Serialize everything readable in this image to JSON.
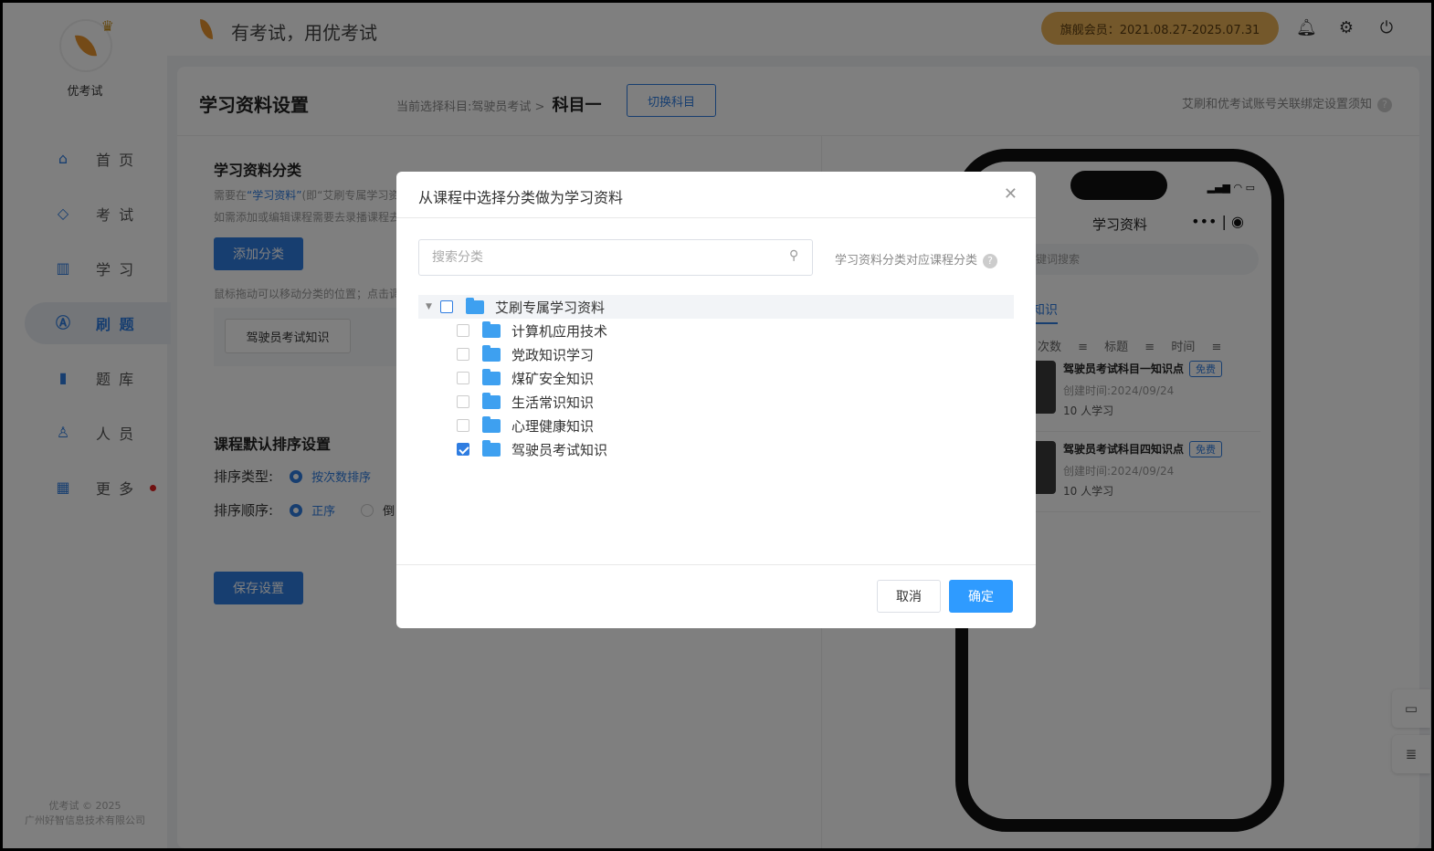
{
  "sidebar": {
    "logo_text": "优考试",
    "items": [
      {
        "label": "首 页",
        "icon": "home-icon"
      },
      {
        "label": "考 试",
        "icon": "eraser-icon"
      },
      {
        "label": "学 习",
        "icon": "book-icon"
      },
      {
        "label": "刷 题",
        "icon": "a-badge-icon"
      },
      {
        "label": "题 库",
        "icon": "bars-icon"
      },
      {
        "label": "人 员",
        "icon": "user-icon"
      },
      {
        "label": "更 多",
        "icon": "apps-icon"
      }
    ],
    "copyright_line1": "优考试 © 2025",
    "copyright_line2": "广州好智信息技术有限公司"
  },
  "topbar": {
    "slogan": "有考试，用优考试",
    "vip": "旗舰会员：2021.08.27-2025.07.31"
  },
  "header": {
    "title": "学习资料设置",
    "crumb_prefix": "当前选择科目:驾驶员考试 >",
    "crumb_subject": "科目一",
    "switch_label": "切换科目",
    "notice": "艾刷和优考试账号关联绑定设置须知"
  },
  "left": {
    "category_title": "学习资料分类",
    "tip1_pre": "需要在",
    "tip1_link": "“学习资料”",
    "tip1_post": "(即“艾刷专属学习资料",
    "tip2": "如需添加或编辑课程需要去录播课程去",
    "add_label": "添加分类",
    "drag_tip": "鼠标拖动可以移动分类的位置；点击调",
    "tag": "驾驶员考试知识",
    "sort_title": "课程默认排序设置",
    "sort_type_label": "排序类型:",
    "sort_type_value": "按次数排序",
    "sort_order_label": "排序顺序:",
    "sort_order_asc": "正序",
    "sort_order_desc": "倒",
    "save_label": "保存设置"
  },
  "phone": {
    "title": "学习资料",
    "search_placeholder": "键词搜索",
    "tab": "知识",
    "sort_labels": "次数 ≡ 标题 ≡ 时间 ≡",
    "items": [
      {
        "name": "驾驶员考试科目一知识点",
        "badge": "免费",
        "date": "创建时间:2024/09/24",
        "count": "10 人学习"
      },
      {
        "name": "驾驶员考试科目四知识点",
        "badge": "免费",
        "date": "创建时间:2024/09/24",
        "count": "10 人学习"
      }
    ]
  },
  "dialog": {
    "title": "从课程中选择分类做为学习资料",
    "search_placeholder": "搜索分类",
    "hint": "学习资料分类对应课程分类",
    "tree": {
      "root": "艾刷专属学习资料",
      "children": [
        {
          "label": "计算机应用技术",
          "checked": false
        },
        {
          "label": "党政知识学习",
          "checked": false
        },
        {
          "label": "煤矿安全知识",
          "checked": false
        },
        {
          "label": "生活常识知识",
          "checked": false
        },
        {
          "label": "心理健康知识",
          "checked": false
        },
        {
          "label": "驾驶员考试知识",
          "checked": true
        }
      ]
    },
    "cancel_label": "取消",
    "ok_label": "确定"
  },
  "colors": {
    "primary": "#2f7de1",
    "confirm": "#2f9bff",
    "vip": "#e8b056",
    "folder": "#3ea0f0"
  }
}
